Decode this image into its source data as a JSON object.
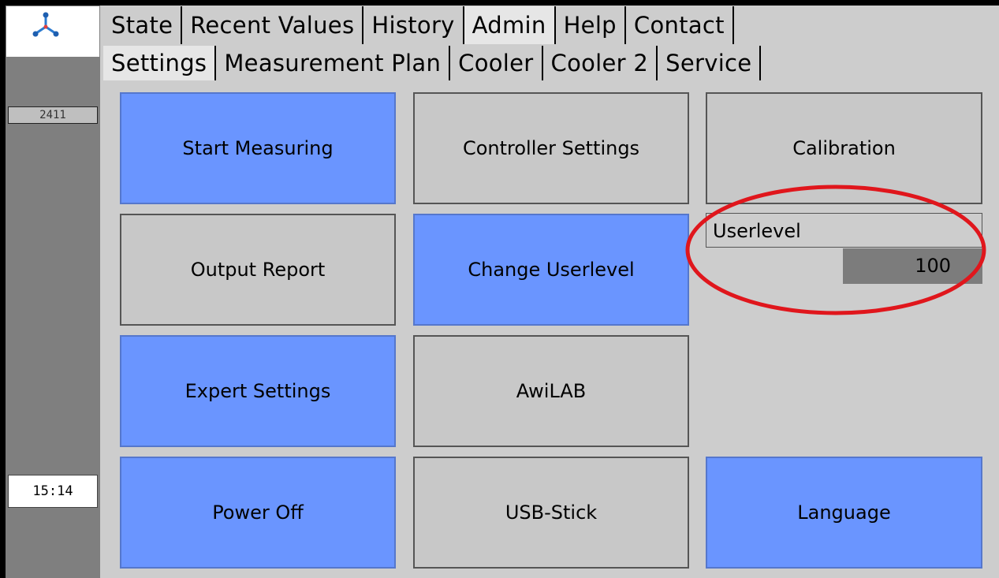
{
  "sidebar": {
    "serial": "2411",
    "clock": "15:14"
  },
  "tabs_top": [
    "State",
    "Recent Values",
    "History",
    "Admin",
    "Help",
    "Contact"
  ],
  "tabs_sub": [
    "Settings",
    "Measurement Plan",
    "Cooler",
    "Cooler 2",
    "Service"
  ],
  "buttons": {
    "start_measuring": "Start Measuring",
    "controller_settings": "Controller Settings",
    "calibration": "Calibration",
    "output_report": "Output Report",
    "change_userlevel": "Change Userlevel",
    "expert_settings": "Expert Settings",
    "awilab": "AwiLAB",
    "power_off": "Power Off",
    "usb_stick": "USB-Stick",
    "language": "Language"
  },
  "userlevel": {
    "label": "Userlevel",
    "value": "100"
  },
  "colors": {
    "button_blue": "#6a95ff",
    "button_gray": "#c8c8c8",
    "sidebar": "#7f7f7f",
    "highlight_ring": "#e0161c"
  },
  "icons": {
    "logo": "molecule-logo-icon"
  }
}
